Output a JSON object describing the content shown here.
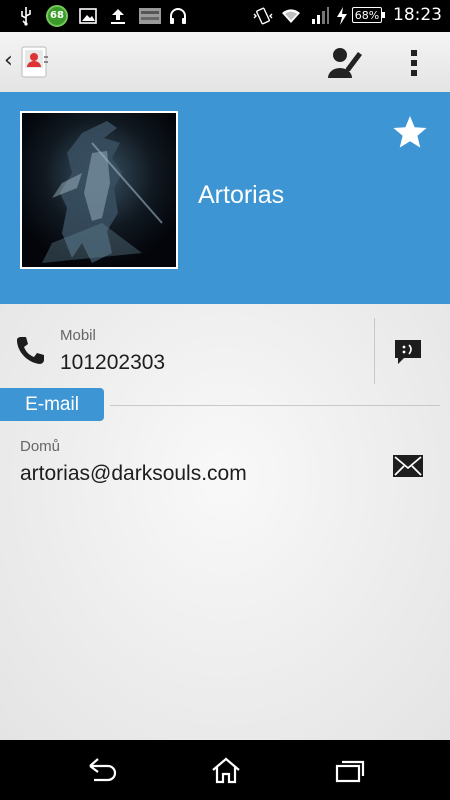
{
  "status_bar": {
    "notification_count": "68",
    "battery_percent": "68%",
    "time": "18:23"
  },
  "action_bar": {
    "icons": [
      "back-chevron-icon",
      "contacts-app-icon",
      "edit-contact-icon",
      "overflow-menu-icon"
    ]
  },
  "contact": {
    "name": "Artorias",
    "starred": true
  },
  "phone": {
    "type": "Mobil",
    "number": "101202303"
  },
  "email_section": {
    "label": "E-mail",
    "type": "Domů",
    "address": "artorias@darksouls.com"
  },
  "colors": {
    "accent": "#3d95d3",
    "background": "#ededed"
  }
}
